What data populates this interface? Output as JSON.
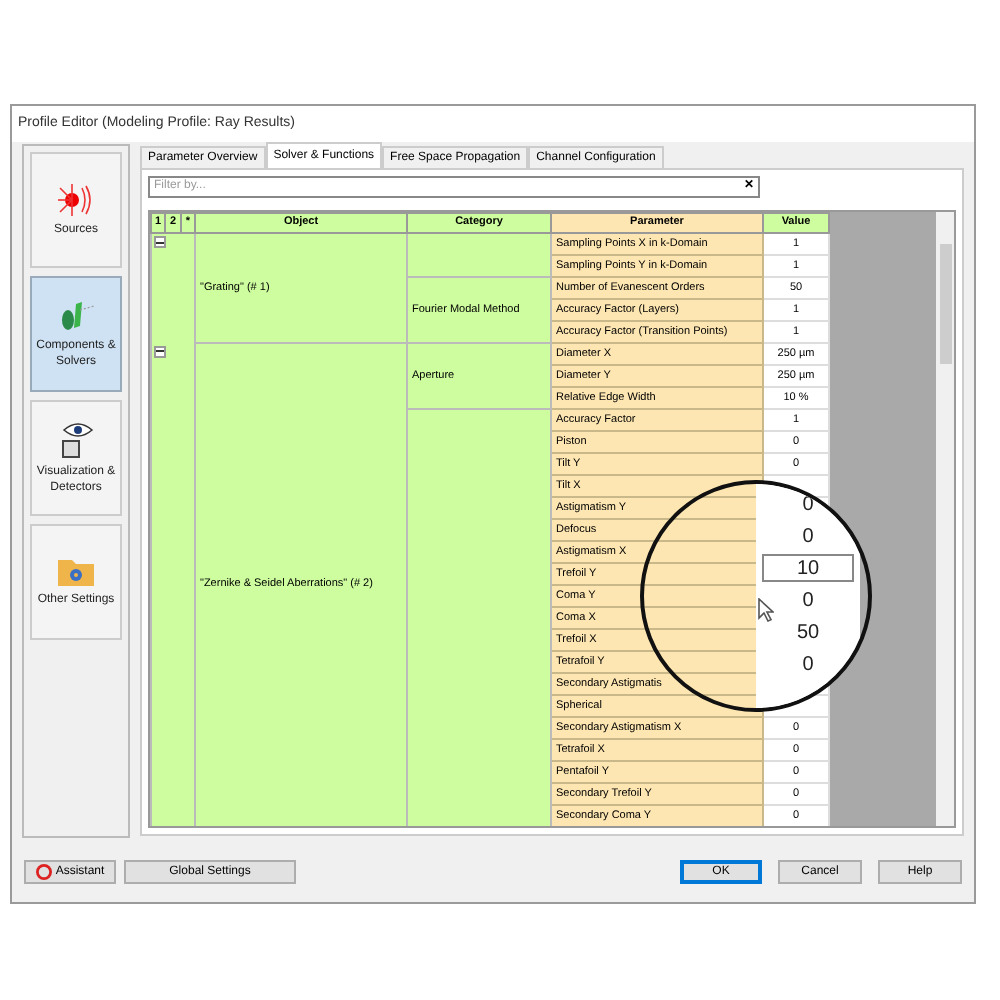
{
  "window": {
    "title": "Profile Editor (Modeling Profile: Ray Results)"
  },
  "sidebar": {
    "items": [
      {
        "label": "Sources",
        "kind": "sources",
        "selected": false
      },
      {
        "label": "Components & Solvers",
        "kind": "components",
        "selected": true
      },
      {
        "label": "Visualization & Detectors",
        "kind": "detectors",
        "selected": false
      },
      {
        "label": "Other Settings",
        "kind": "settings",
        "selected": false
      }
    ]
  },
  "tabs": [
    {
      "label": "Parameter Overview",
      "selected": false
    },
    {
      "label": "Solver & Functions",
      "selected": true
    },
    {
      "label": "Free Space Propagation",
      "selected": false
    },
    {
      "label": "Channel Configuration",
      "selected": false
    }
  ],
  "filter": {
    "placeholder": "Filter by...",
    "clear": "✕"
  },
  "table": {
    "columns": [
      "1",
      "2",
      "*",
      "Object",
      "Category",
      "Parameter",
      "Value"
    ],
    "objects": [
      {
        "name": "\"Grating\" (# 1)",
        "expanded": true,
        "categories": [
          {
            "parameters": [
              {
                "name": "Sampling Points X in k-Domain",
                "value": "1"
              },
              {
                "name": "Sampling Points Y in k-Domain",
                "value": "1"
              }
            ]
          },
          {
            "name": "Fourier Modal Method",
            "parameters": [
              {
                "name": "Number of Evanescent Orders",
                "value": "50"
              },
              {
                "name": "Accuracy Factor (Layers)",
                "value": "1"
              },
              {
                "name": "Accuracy Factor (Transition Points)",
                "value": "1"
              }
            ]
          }
        ]
      },
      {
        "name": "\"Zernike & Seidel Aberrations\" (# 2)",
        "expanded": true,
        "categories": [
          {
            "name": "Aperture",
            "parameters": [
              {
                "name": "Diameter X",
                "value": "250 µm"
              },
              {
                "name": "Diameter Y",
                "value": "250 µm"
              },
              {
                "name": "Relative Edge Width",
                "value": "10 %"
              }
            ]
          },
          {
            "parameters": [
              {
                "name": "Accuracy Factor",
                "value": "1"
              },
              {
                "name": "Piston",
                "value": "0"
              },
              {
                "name": "Tilt Y",
                "value": "0"
              },
              {
                "name": "Tilt X"
              },
              {
                "name": "Astigmatism Y"
              },
              {
                "name": "Defocus"
              },
              {
                "name": "Astigmatism X"
              },
              {
                "name": "Trefoil Y"
              },
              {
                "name": "Coma Y"
              },
              {
                "name": "Coma X"
              },
              {
                "name": "Trefoil X"
              },
              {
                "name": "Tetrafoil Y"
              },
              {
                "name": "Secondary Astigmatis"
              },
              {
                "name": "Spherical"
              },
              {
                "name": "Secondary Astigmatism X",
                "value": "0"
              },
              {
                "name": "Tetrafoil X",
                "value": "0"
              },
              {
                "name": "Pentafoil Y",
                "value": "0"
              },
              {
                "name": "Secondary Trefoil Y",
                "value": "0"
              },
              {
                "name": "Secondary Coma Y",
                "value": "0"
              }
            ]
          }
        ]
      }
    ]
  },
  "magnifier": {
    "values": [
      {
        "text": "0",
        "editing": false
      },
      {
        "text": "0",
        "editing": false
      },
      {
        "text": "10",
        "editing": true
      },
      {
        "text": "0",
        "editing": false
      },
      {
        "text": "50",
        "editing": false
      },
      {
        "text": "0",
        "editing": false
      }
    ]
  },
  "buttons": [
    {
      "label": "Assistant",
      "kind": "assistant",
      "default": false
    },
    {
      "label": "Global Settings",
      "kind": "plain",
      "default": false
    },
    {
      "label": "OK",
      "kind": "plain",
      "default": true
    },
    {
      "label": "Cancel",
      "kind": "plain",
      "default": false
    },
    {
      "label": "Help",
      "kind": "plain",
      "default": false
    }
  ]
}
